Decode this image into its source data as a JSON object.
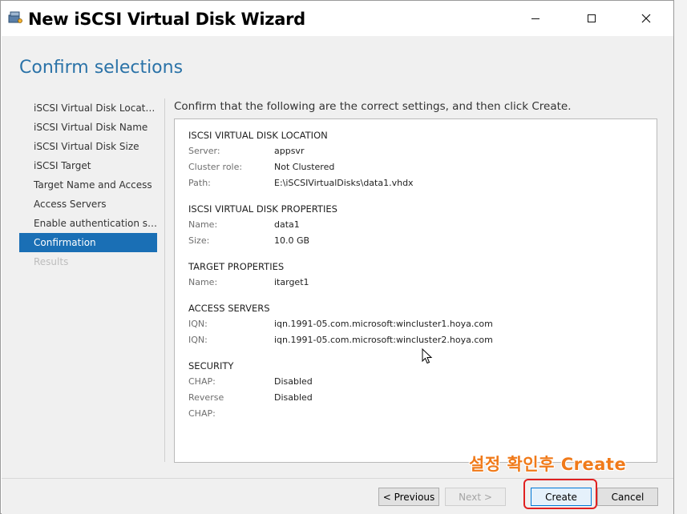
{
  "window": {
    "title": "New iSCSI Virtual Disk Wizard"
  },
  "header": {
    "title": "Confirm selections"
  },
  "nav": {
    "items": [
      {
        "label": "iSCSI Virtual Disk Location",
        "state": "normal"
      },
      {
        "label": "iSCSI Virtual Disk Name",
        "state": "normal"
      },
      {
        "label": "iSCSI Virtual Disk Size",
        "state": "normal"
      },
      {
        "label": "iSCSI Target",
        "state": "normal"
      },
      {
        "label": "Target Name and Access",
        "state": "normal"
      },
      {
        "label": "Access Servers",
        "state": "normal"
      },
      {
        "label": "Enable authentication ser...",
        "state": "normal"
      },
      {
        "label": "Confirmation",
        "state": "active"
      },
      {
        "label": "Results",
        "state": "disabled"
      }
    ]
  },
  "intro": "Confirm that the following are the correct settings, and then click Create.",
  "summary": {
    "location": {
      "title": "ISCSI VIRTUAL DISK LOCATION",
      "rows": [
        {
          "key": "Server:",
          "value": "appsvr"
        },
        {
          "key": "Cluster role:",
          "value": "Not Clustered"
        },
        {
          "key": "Path:",
          "value": "E:\\iSCSIVirtualDisks\\data1.vhdx"
        }
      ]
    },
    "properties": {
      "title": "ISCSI VIRTUAL DISK PROPERTIES",
      "rows": [
        {
          "key": "Name:",
          "value": "data1"
        },
        {
          "key": "Size:",
          "value": "10.0 GB"
        }
      ]
    },
    "target": {
      "title": "TARGET PROPERTIES",
      "rows": [
        {
          "key": "Name:",
          "value": "itarget1"
        }
      ]
    },
    "access": {
      "title": "ACCESS SERVERS",
      "rows": [
        {
          "key": "IQN:",
          "value": "iqn.1991-05.com.microsoft:wincluster1.hoya.com"
        },
        {
          "key": "IQN:",
          "value": "iqn.1991-05.com.microsoft:wincluster2.hoya.com"
        }
      ]
    },
    "security": {
      "title": "SECURITY",
      "rows": [
        {
          "key": "CHAP:",
          "value": "Disabled"
        },
        {
          "key": "Reverse CHAP:",
          "value": "Disabled"
        }
      ]
    }
  },
  "footer": {
    "previous_label": "< Previous",
    "next_label": "Next >",
    "create_label": "Create",
    "cancel_label": "Cancel"
  },
  "annotation": "설정 확인후 Create",
  "colors": {
    "accent": "#1a6fb5",
    "header_text": "#2b73a8",
    "annotation": "#f07a1a",
    "highlight": "#e02020"
  }
}
